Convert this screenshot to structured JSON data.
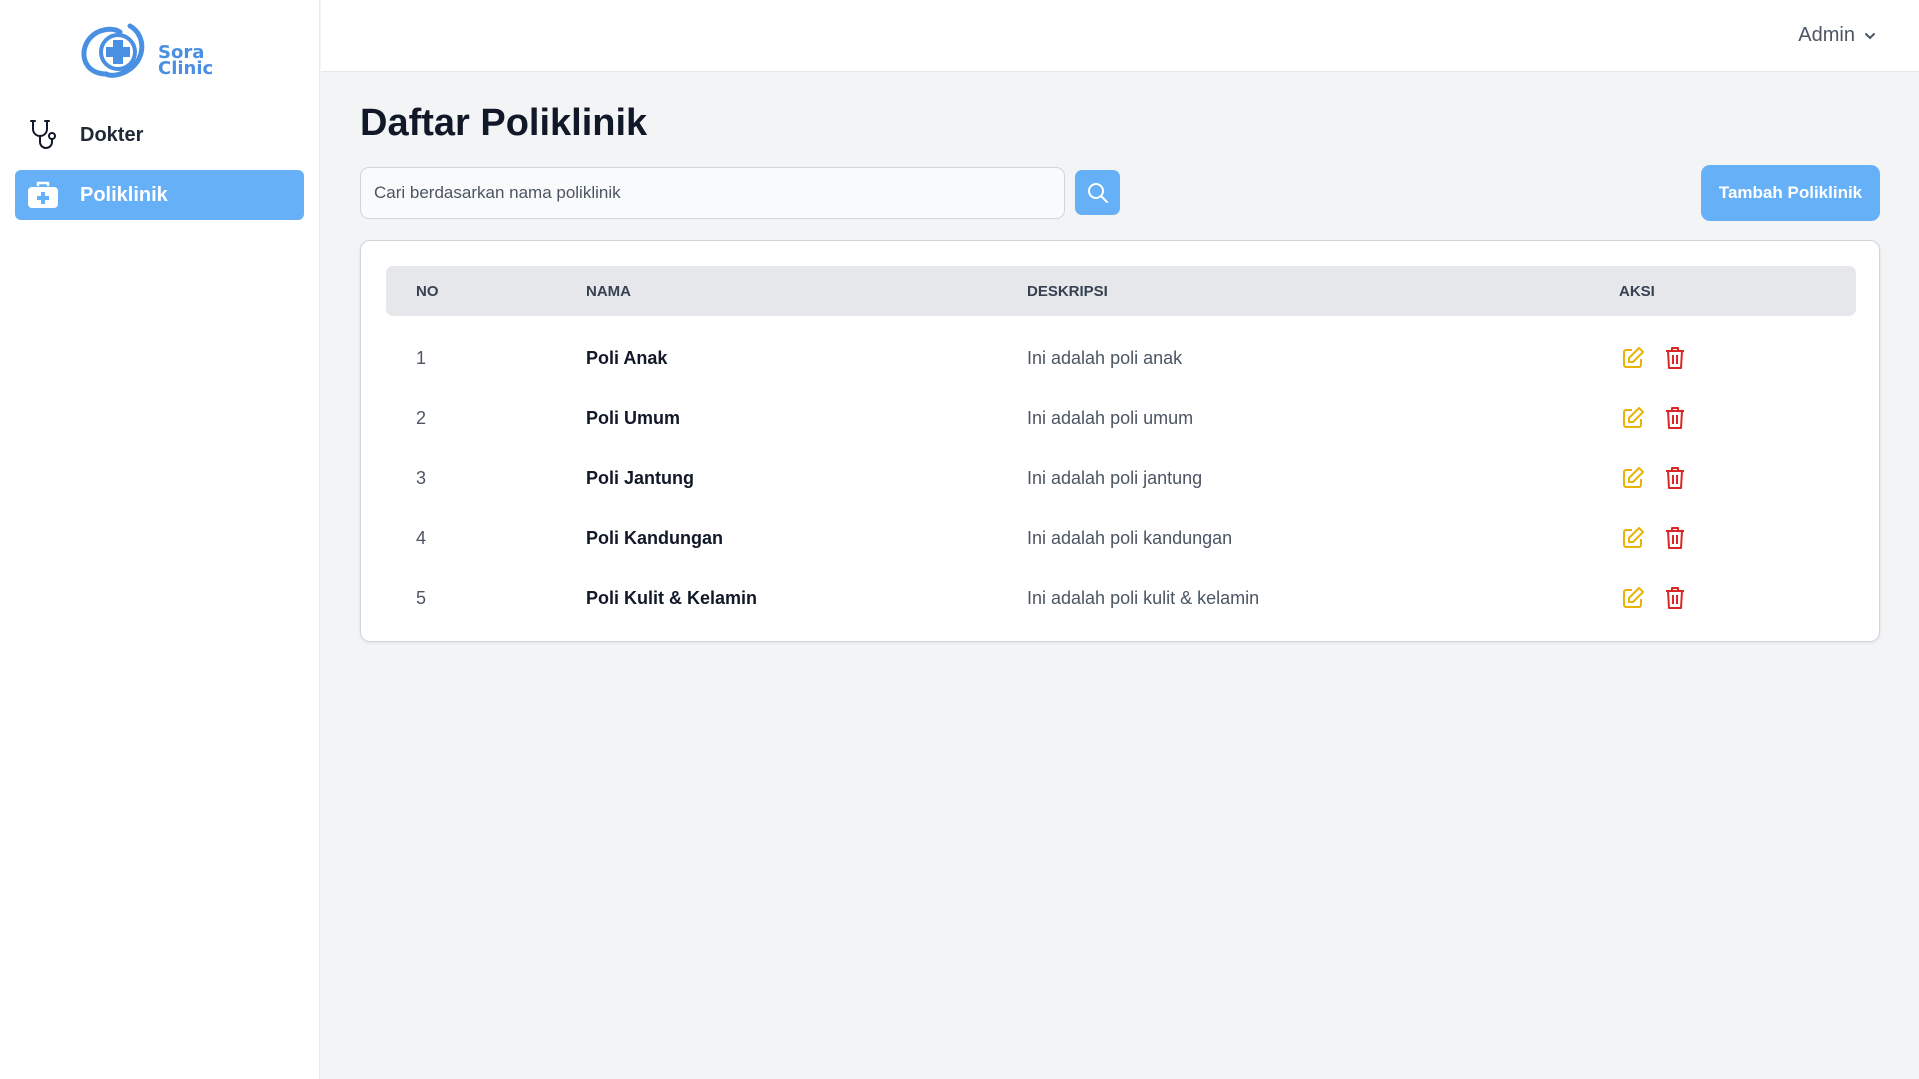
{
  "brand": {
    "line1": "Sora",
    "line2": "Clinic",
    "accent": "#4a90e2"
  },
  "sidebar": {
    "items": [
      {
        "label": "Dokter",
        "icon": "stethoscope-icon",
        "active": false
      },
      {
        "label": "Poliklinik",
        "icon": "medical-kit-icon",
        "active": true
      }
    ]
  },
  "header": {
    "user": "Admin"
  },
  "main": {
    "title": "Daftar Poliklinik",
    "search": {
      "placeholder": "Cari berdasarkan nama poliklinik",
      "value": ""
    },
    "add_label": "Tambah Poliklinik",
    "table": {
      "columns": [
        "NO",
        "NAMA",
        "DESKRIPSI",
        "AKSI"
      ],
      "rows": [
        {
          "no": "1",
          "nama": "Poli Anak",
          "deskripsi": "Ini adalah poli anak"
        },
        {
          "no": "2",
          "nama": "Poli Umum",
          "deskripsi": "Ini adalah poli umum"
        },
        {
          "no": "3",
          "nama": "Poli Jantung",
          "deskripsi": "Ini adalah poli jantung"
        },
        {
          "no": "4",
          "nama": "Poli Kandungan",
          "deskripsi": "Ini adalah poli kandungan"
        },
        {
          "no": "5",
          "nama": "Poli Kulit & Kelamin",
          "deskripsi": "Ini adalah poli kulit & kelamin"
        }
      ]
    }
  },
  "colors": {
    "primary": "#66b0f7",
    "edit": "#eab308",
    "delete": "#dc2626",
    "background": "#f3f4f6"
  }
}
